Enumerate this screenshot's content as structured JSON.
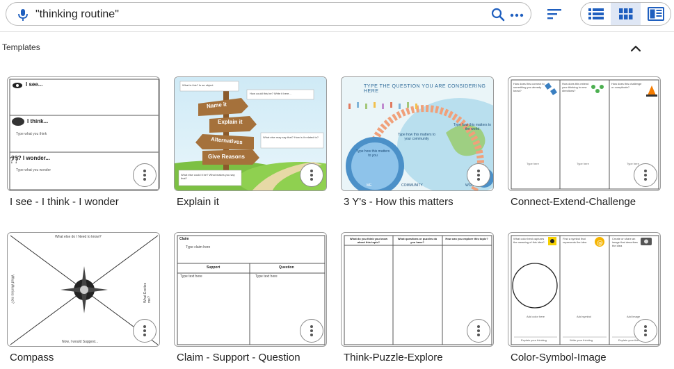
{
  "search": {
    "query": "\"thinking routine\"",
    "mic_icon": "microphone-icon",
    "search_icon": "magnifier-icon",
    "more_icon": "more-horizontal-icon"
  },
  "toolbar": {
    "sort_icon": "sort-icon",
    "view_modes": [
      "list",
      "grid",
      "preview"
    ],
    "active_view": "grid"
  },
  "section": {
    "title": "Templates",
    "collapse_icon": "chevron-up-icon"
  },
  "colors": {
    "accent": "#1f5fbf",
    "active_view_bg": "#dfe7f5"
  },
  "templates": [
    {
      "name": "I see - I think - I wonder",
      "thumb": {
        "row1": "I see...",
        "row2": "I think...",
        "row2_sub": "Type what you think",
        "row3": "??? I wonder...",
        "row3_sub": "Type what you wonder"
      }
    },
    {
      "name": "Explain it",
      "thumb": {
        "sign1": "Name it",
        "sign2": "Explain it",
        "sign3": "Alternatives",
        "sign4": "Give Reasons",
        "box1": "What is this? Is an object",
        "box2": "How could this be? Write it here...",
        "box3": "What else may say that? How is it related to?",
        "box4": "What else could it be? What makes you say that?"
      }
    },
    {
      "name": "3 Y's - How this matters",
      "thumb": {
        "heading": "TYPE THE QUESTION YOU ARE CONSIDERING HERE",
        "c1": "Type how this matters to you",
        "c2": "Type how this matters to your community",
        "c3": "Type how this matters to the world",
        "lbl1": "ME",
        "lbl2": "COMMUNITY",
        "lbl3": "WORLD"
      }
    },
    {
      "name": "Connect-Extend-Challenge",
      "thumb": {
        "col1": "How does this connect to something you already know?",
        "col2": "How does this extend your thinking in new directions?",
        "col3": "How does this challenge or complicate?",
        "type1": "Type here",
        "type2": "Type here",
        "type3": "Type here"
      }
    },
    {
      "name": "Compass",
      "thumb": {
        "n": "What else do I Need to know?",
        "s": "Now, I would Suggest...",
        "w": "What Worries me?",
        "e": "What Excites me?"
      }
    },
    {
      "name": "Claim - Support - Question",
      "thumb": {
        "claim": "Claim",
        "claim_sub": "Type claim here",
        "support": "Support",
        "question": "Question",
        "support_sub": "Type text here",
        "question_sub": "Type text here"
      }
    },
    {
      "name": "Think-Puzzle-Explore",
      "thumb": {
        "col1": "What do you think you know about this topic?",
        "col2": "What questions or puzzles do you have?",
        "col3": "How can you explore this topic?"
      }
    },
    {
      "name": "Color-Symbol-Image",
      "thumb": {
        "col1": "What color best captures the meaning of this idea?",
        "col2": "Find a symbol that represents the idea",
        "col3": "Create or share an image that describes the idea",
        "sub1": "Add color here",
        "sub2": "Add symbol",
        "sub3": "Add image",
        "foot1": "Explain your thinking",
        "foot2": "Write your thinking",
        "foot3": "Explain your thinking"
      }
    }
  ]
}
